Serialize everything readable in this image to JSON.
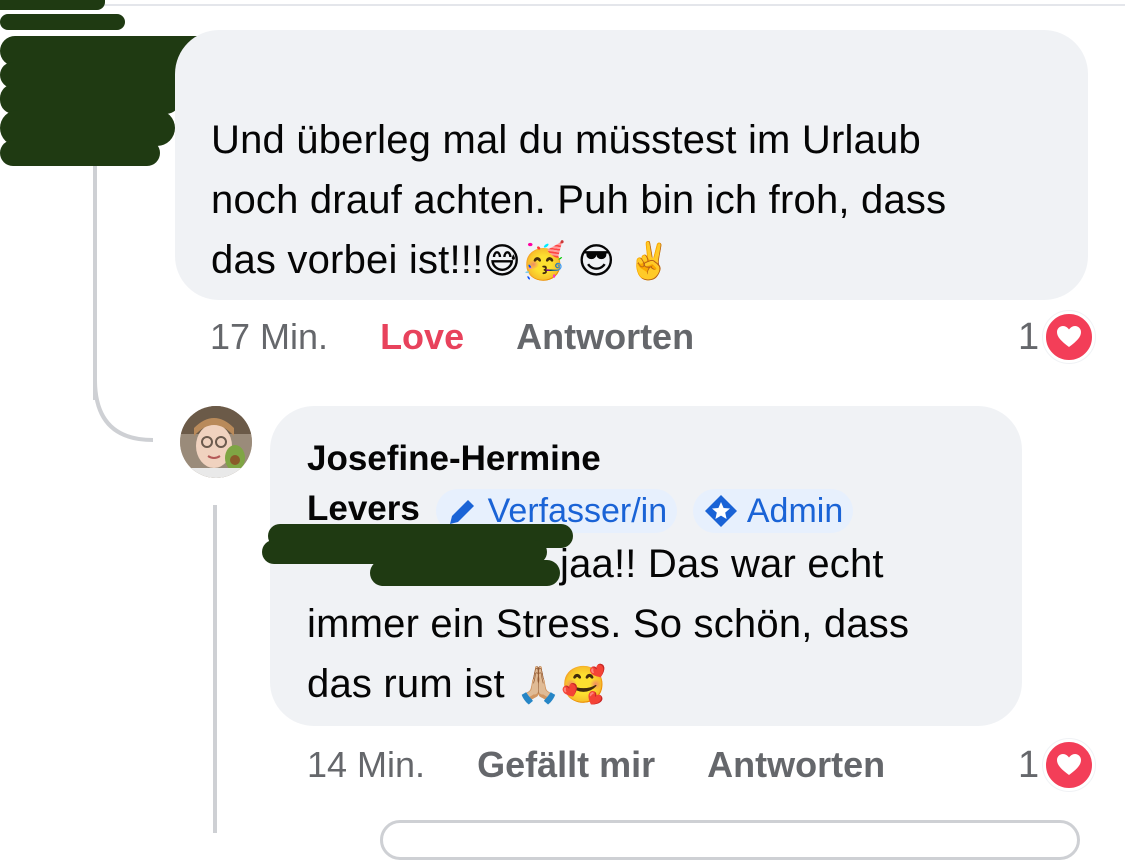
{
  "comment1": {
    "text_lines": [
      "Und überleg mal du müsstest im Urlaub",
      "noch drauf achten. Puh bin ich froh, dass",
      "das vorbei ist!!!"
    ],
    "emojis": [
      "😅",
      "🥳",
      "😎",
      "✌️"
    ],
    "time": "17 Min.",
    "reaction_label": "Love",
    "reply_label": "Antworten",
    "reaction_count": "1"
  },
  "comment2": {
    "author_first": "Josefine-Hermine",
    "author_last": "Levers",
    "badges": {
      "author": "Verfasser/in",
      "admin": "Admin"
    },
    "text_first": "jaa!! Das war echt",
    "text_lines": [
      "immer ein Stress. So schön, dass",
      "das rum ist"
    ],
    "emojis": [
      "🙏🏼",
      "🥰"
    ],
    "time": "14 Min.",
    "like_label": "Gefällt mir",
    "reply_label": "Antworten",
    "reaction_count": "1"
  },
  "colors": {
    "bubble": "#f0f2f5",
    "love": "#e8425c",
    "badge_text": "#1a63d6",
    "badge_bg": "#e7f0fd",
    "heart": "#f33e58",
    "muted": "#65676b",
    "redaction": "#1f3a12"
  },
  "icons": [
    "pencil-icon",
    "admin-star-icon",
    "heart-reaction-icon"
  ]
}
